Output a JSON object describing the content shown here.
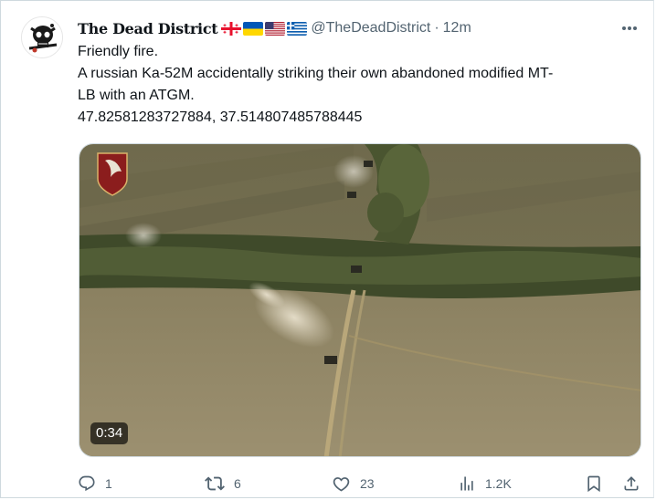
{
  "tweet": {
    "display_name": "The Dead District",
    "flags": [
      "georgia-flag-icon",
      "ukraine-flag-icon",
      "usa-flag-icon",
      "greece-flag-icon"
    ],
    "handle": "@TheDeadDistrict",
    "separator": "·",
    "time": "12m",
    "text_lines": [
      "Friendly fire.",
      "A russian Ka-52M accidentally striking their own abandoned modified MT-",
      "LB with an ATGM.",
      "47.82581283727884, 37.514807485788445"
    ],
    "media": {
      "type": "video",
      "duration": "0:34"
    },
    "actions": {
      "replies": "1",
      "reposts": "6",
      "likes": "23",
      "views": "1.2K"
    }
  },
  "colors": {
    "text_primary": "#0f1419",
    "text_secondary": "#536471",
    "border": "#cfd9de"
  }
}
